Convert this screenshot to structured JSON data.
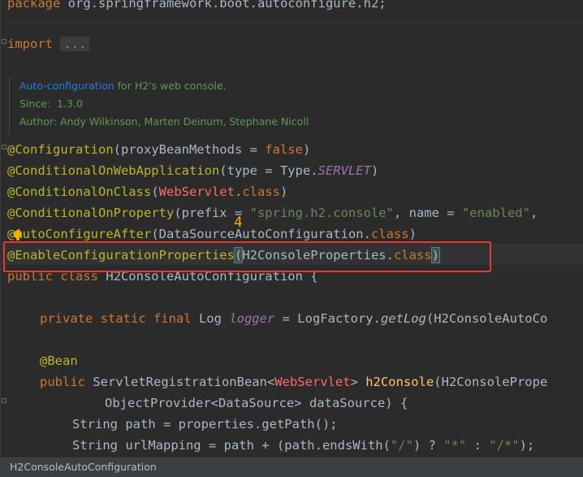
{
  "code": {
    "package_kw": "package",
    "package_name": " org.springframework.boot.autoconfigure.h2;",
    "import_kw": "import",
    "import_collapsed": "...",
    "doc": {
      "line1_link": "Auto-configuration",
      "line1_rest": " for H2's web console.",
      "since_label": "Since:",
      "since_value": "1.3.0",
      "author": "Author: Andy Wilkinson, Marten Deinum, Stephane Nicoll"
    },
    "ann1": {
      "name": "@Configuration",
      "open": "(proxyBeanMethods = ",
      "val": "false",
      "close": ")"
    },
    "ann2": {
      "name": "@ConditionalOnWebApplication",
      "open": "(type = Type.",
      "val": "SERVLET",
      "close": ")"
    },
    "ann3": {
      "name": "@ConditionalOnClass",
      "open": "(",
      "ref": "WebServlet",
      "dot": ".",
      "kw": "class",
      "close": ")"
    },
    "ann4": {
      "name": "@ConditionalOnProperty",
      "open": "(prefix = ",
      "str1": "\"spring.h2.console\"",
      "mid": ", name = ",
      "str2": "\"enabled\"",
      "tail": ","
    },
    "ann5": {
      "name": "@AutoConfigureAfter",
      "open": "(DataSourceAutoConfiguration.",
      "kw": "class",
      "close": ")"
    },
    "ann6": {
      "name": "@EnableConfigurationProperties",
      "open": "(",
      "ref": "H2ConsoleProperties.",
      "kw": "class",
      "close": ")"
    },
    "class_decl": {
      "kw": "public class",
      "name": " H2ConsoleAutoConfiguration {"
    },
    "logger": {
      "kw": "private static final",
      "type": " Log ",
      "field": "logger",
      "eq": " = LogFactory.",
      "method": "getLog",
      "rest": "(H2ConsoleAutoCo"
    },
    "bean_ann": "@Bean",
    "bean_method": {
      "kw": "public",
      "ret": " ServletRegistrationBean<",
      "ref": "WebServlet",
      "gt": "> ",
      "name": "h2Console",
      "rest": "(H2ConsolePrope"
    },
    "param2": "ObjectProvider<DataSource> dataSource) {",
    "path_line": "String path = properties.getPath();",
    "url_line": {
      "pre": "String urlMapping = path + (path.endsWith(",
      "s1": "\"/\"",
      "mid": ") ? ",
      "s2": "\"*\"",
      "colon": " : ",
      "s3": "\"/*\"",
      "end": ");"
    }
  },
  "annotation_number": "4",
  "statusbar": {
    "breadcrumb": "H2ConsoleAutoConfiguration"
  }
}
